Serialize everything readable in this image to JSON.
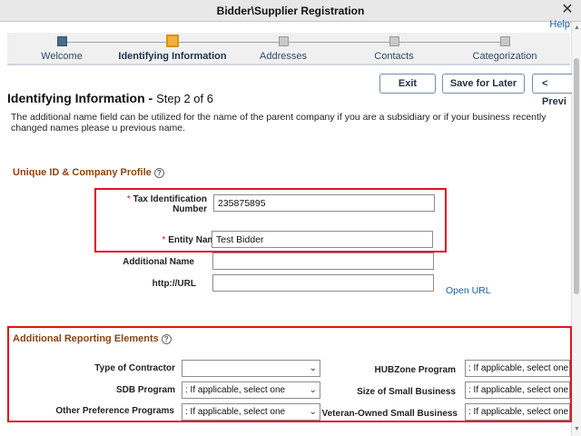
{
  "window": {
    "title": "Bidder\\Supplier Registration",
    "close_glyph": "✕"
  },
  "help_label": "Help",
  "steps": [
    {
      "label": "Welcome",
      "state": "done"
    },
    {
      "label": "Identifying Information",
      "state": "current"
    },
    {
      "label": "Addresses",
      "state": "todo"
    },
    {
      "label": "Contacts",
      "state": "todo"
    },
    {
      "label": "Categorization",
      "state": "todo"
    }
  ],
  "toolbar": {
    "exit_label": "Exit",
    "save_later_label": "Save for Later",
    "previous_label": "< Previ"
  },
  "page": {
    "title": "Identifying Information - ",
    "step_text": "Step 2 of 6",
    "intro": "The additional name field can be utilized for the name of the parent company if you are a subsidiary or if your business recently changed names please u previous name."
  },
  "unique_id": {
    "heading": "Unique ID & Company Profile",
    "help_glyph": "?",
    "required_mark": "*",
    "tin_label": "Tax Identification Number",
    "tin_value": "235875895",
    "entity_label": "Entity Name",
    "entity_value": "Test Bidder",
    "additional_name_label": "Additional Name",
    "additional_name_value": "",
    "url_label": "http://URL",
    "url_value": "",
    "open_url_label": "Open URL"
  },
  "reporting": {
    "heading": "Additional Reporting Elements",
    "help_glyph": "?",
    "type_of_contractor_label": "Type of Contractor",
    "type_of_contractor_value": "",
    "sdb_label": "SDB Program",
    "sdb_value": ": If applicable, select one",
    "other_pref_label": "Other Preference Programs",
    "other_pref_value": ": If applicable, select one",
    "hubzone_label": "HUBZone Program",
    "hubzone_value": ": If applicable, select one",
    "small_biz_label": "Size of Small Business",
    "small_biz_value": ": If applicable, select one",
    "veteran_label": "Veteran-Owned Small Business",
    "veteran_value": ": If applicable, select one"
  },
  "colors": {
    "highlight_red": "#e0141e",
    "section_heading": "#8a4413",
    "link_blue": "#1a5ea8",
    "current_step": "#f0b336"
  }
}
